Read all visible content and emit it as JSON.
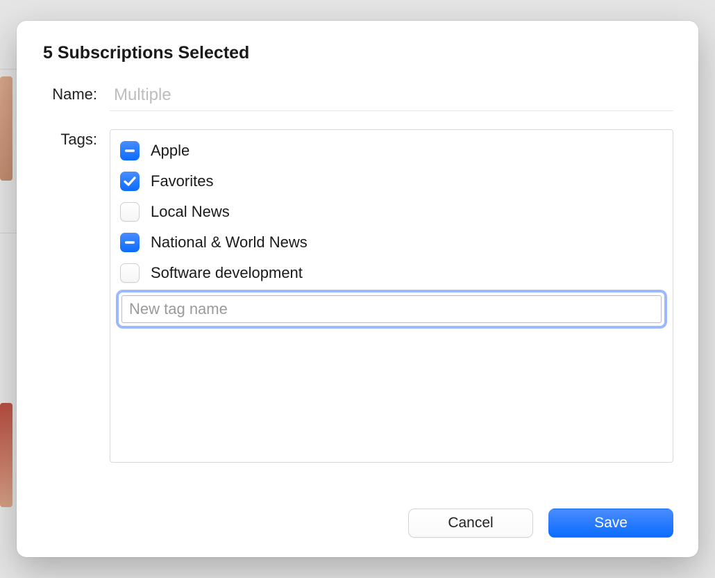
{
  "title": "5 Subscriptions Selected",
  "labels": {
    "name": "Name:",
    "tags": "Tags:"
  },
  "name_field": {
    "value": "",
    "placeholder": "Multiple"
  },
  "tags": [
    {
      "label": "Apple",
      "state": "mixed"
    },
    {
      "label": "Favorites",
      "state": "checked"
    },
    {
      "label": "Local News",
      "state": "unchecked"
    },
    {
      "label": "National & World News",
      "state": "mixed"
    },
    {
      "label": "Software development",
      "state": "unchecked"
    }
  ],
  "new_tag": {
    "value": "",
    "placeholder": "New tag name"
  },
  "buttons": {
    "cancel": "Cancel",
    "save": "Save"
  },
  "colors": {
    "accent": "#0a6cff",
    "focus_ring": "#6b9aff"
  }
}
